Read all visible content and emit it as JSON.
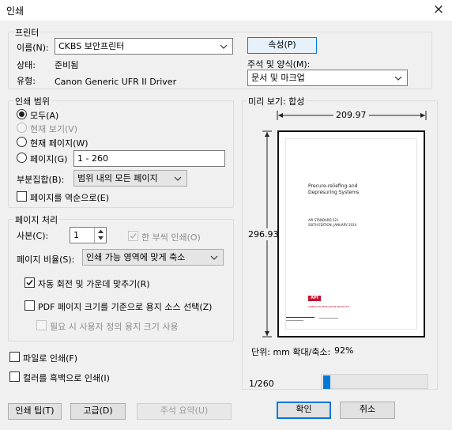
{
  "window": {
    "title": "인쇄",
    "close_icon": "×"
  },
  "printer": {
    "legend": "프린터",
    "name_label": "이름(N):",
    "name_value": "CKBS 보안프린터",
    "status_label": "상태:",
    "status_value": "준비됨",
    "type_label": "유형:",
    "type_value": "Canon Generic UFR II Driver",
    "properties_button": "속성(P)",
    "comments_label": "주석 및 양식(M):",
    "comments_value": "문서 및 마크업"
  },
  "print_range": {
    "legend": "인쇄 범위",
    "all": "모두(A)",
    "current_view": "현재 보기(V)",
    "current_page": "현재 페이지(W)",
    "pages": "페이지(G)",
    "pages_value": "1 - 260",
    "subset_label": "부분집합(B):",
    "subset_value": "범위 내의 모든 페이지",
    "reverse": "페이지를 역순으로(E)"
  },
  "page_handling": {
    "legend": "페이지 처리",
    "copies_label": "사본(C):",
    "copies_value": "1",
    "collate": "한 부씩 인쇄(O)",
    "scaling_label": "페이지 비율(S):",
    "scaling_value": "인쇄 가능 영역에 맞게 축소",
    "auto_rotate": "자동 회전 및 가운데 맞추기(R)",
    "pdf_page_size": "PDF 페이지 크기를 기준으로 용지 소스 선택(Z)",
    "custom_paper": "필요 시 사용자 정의 용지 크기 사용"
  },
  "options": {
    "print_to_file": "파일로 인쇄(F)",
    "grayscale": "컬러를 흑백으로 인쇄(I)"
  },
  "preview": {
    "legend": "미리 보기: 합성",
    "width": "209.97",
    "height": "296.93",
    "doc_title_line1": "Precure-reliefing and",
    "doc_title_line2": "Depresuring Systems",
    "doc_std_line1": "API STANDARD 521",
    "doc_std_line2": "SIXTH EDITION, JANUARY 2014",
    "doc_logo": "API",
    "doc_small_text": "AMERICAN PETROLEUM INSTITUTE",
    "units_label": "단위: mm 확대/축소:",
    "zoom_value": "92%",
    "page_indicator": "1/260",
    "slider_position": 0.0
  },
  "buttons": {
    "print_tips": "인쇄 팁(T)",
    "advanced": "고급(D)",
    "summarize": "주석 요약(U)",
    "ok": "확인",
    "cancel": "취소"
  }
}
